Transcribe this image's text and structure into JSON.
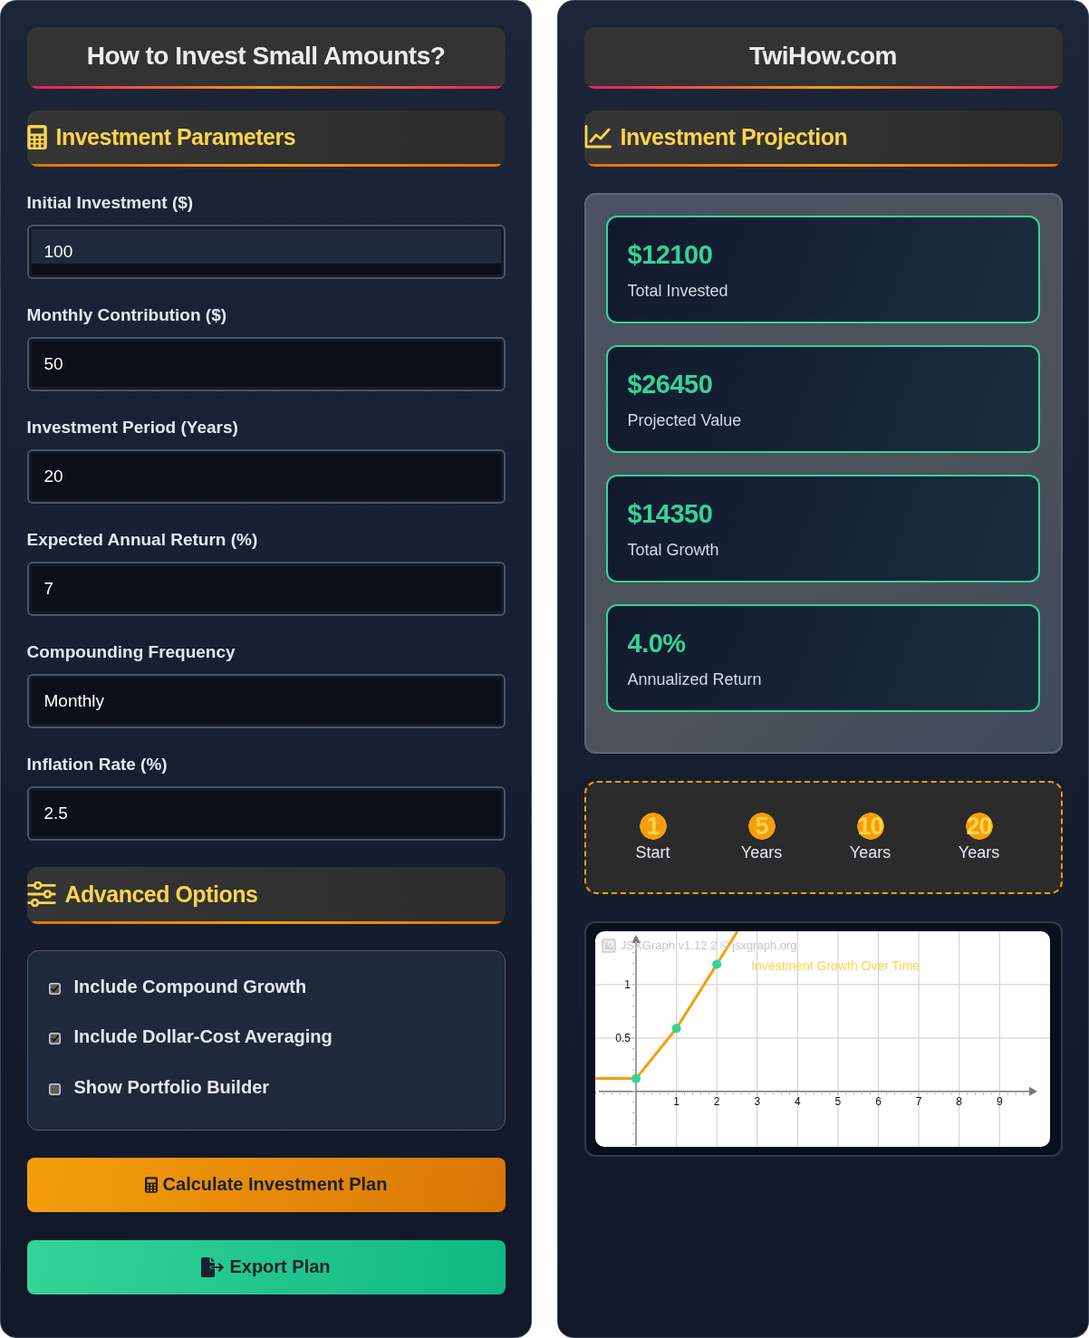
{
  "left_panel": {
    "title": "How to Invest Small Amounts?",
    "parameters": {
      "heading": "Investment Parameters",
      "fields": [
        {
          "label": "Initial Investment ($)",
          "value": "100",
          "focused": true
        },
        {
          "label": "Monthly Contribution ($)",
          "value": "50",
          "focused": false
        },
        {
          "label": "Investment Period (Years)",
          "value": "20",
          "focused": false
        },
        {
          "label": "Expected Annual Return (%)",
          "value": "7",
          "focused": false
        },
        {
          "label": "Compounding Frequency",
          "value": "Monthly",
          "focused": false
        },
        {
          "label": "Inflation Rate (%)",
          "value": "2.5",
          "focused": false
        }
      ]
    },
    "advanced": {
      "heading": "Advanced Options",
      "options": [
        {
          "label": "Include Compound Growth",
          "checked": true
        },
        {
          "label": "Include Dollar-Cost Averaging",
          "checked": true
        },
        {
          "label": "Show Portfolio Builder",
          "checked": false
        }
      ]
    },
    "buttons": [
      {
        "kind": "calculate",
        "label": "Calculate Investment Plan"
      },
      {
        "kind": "export",
        "label": "Export Plan"
      }
    ]
  },
  "right_panel": {
    "title": "TwiHow.com",
    "projection": {
      "heading": "Investment Projection",
      "results": [
        {
          "value": "$12100",
          "label": "Total Invested"
        },
        {
          "value": "$26450",
          "label": "Projected Value"
        },
        {
          "value": "$14350",
          "label": "Total Growth"
        },
        {
          "value": "4.0%",
          "label": "Annualized Return"
        }
      ]
    },
    "milestones": [
      {
        "number": "1",
        "label": "Start"
      },
      {
        "number": "5",
        "label": "Years"
      },
      {
        "number": "10",
        "label": "Years"
      },
      {
        "number": "20",
        "label": "Years"
      }
    ],
    "chart": {
      "credit": "JSXGraph v1.12.2 © jsxgraph.org",
      "chart_data": {
        "type": "line",
        "title": "Investment Growth Over Time",
        "x": [
          -1.01,
          0,
          1,
          2,
          2.51
        ],
        "series": [
          {
            "color": "#f59e0b",
            "marker": "circle",
            "values": [
              0.12,
              0.12,
              0.59,
              1.19,
              1.5
            ]
          }
        ],
        "grid": true,
        "xlim": [
          -1.01,
          10.25
        ],
        "ylim": [
          -0.52,
          1.5
        ],
        "xticks": [
          1,
          2,
          3,
          4,
          5,
          6,
          7,
          8,
          9
        ],
        "yticks": [
          0.5,
          1
        ]
      }
    }
  }
}
